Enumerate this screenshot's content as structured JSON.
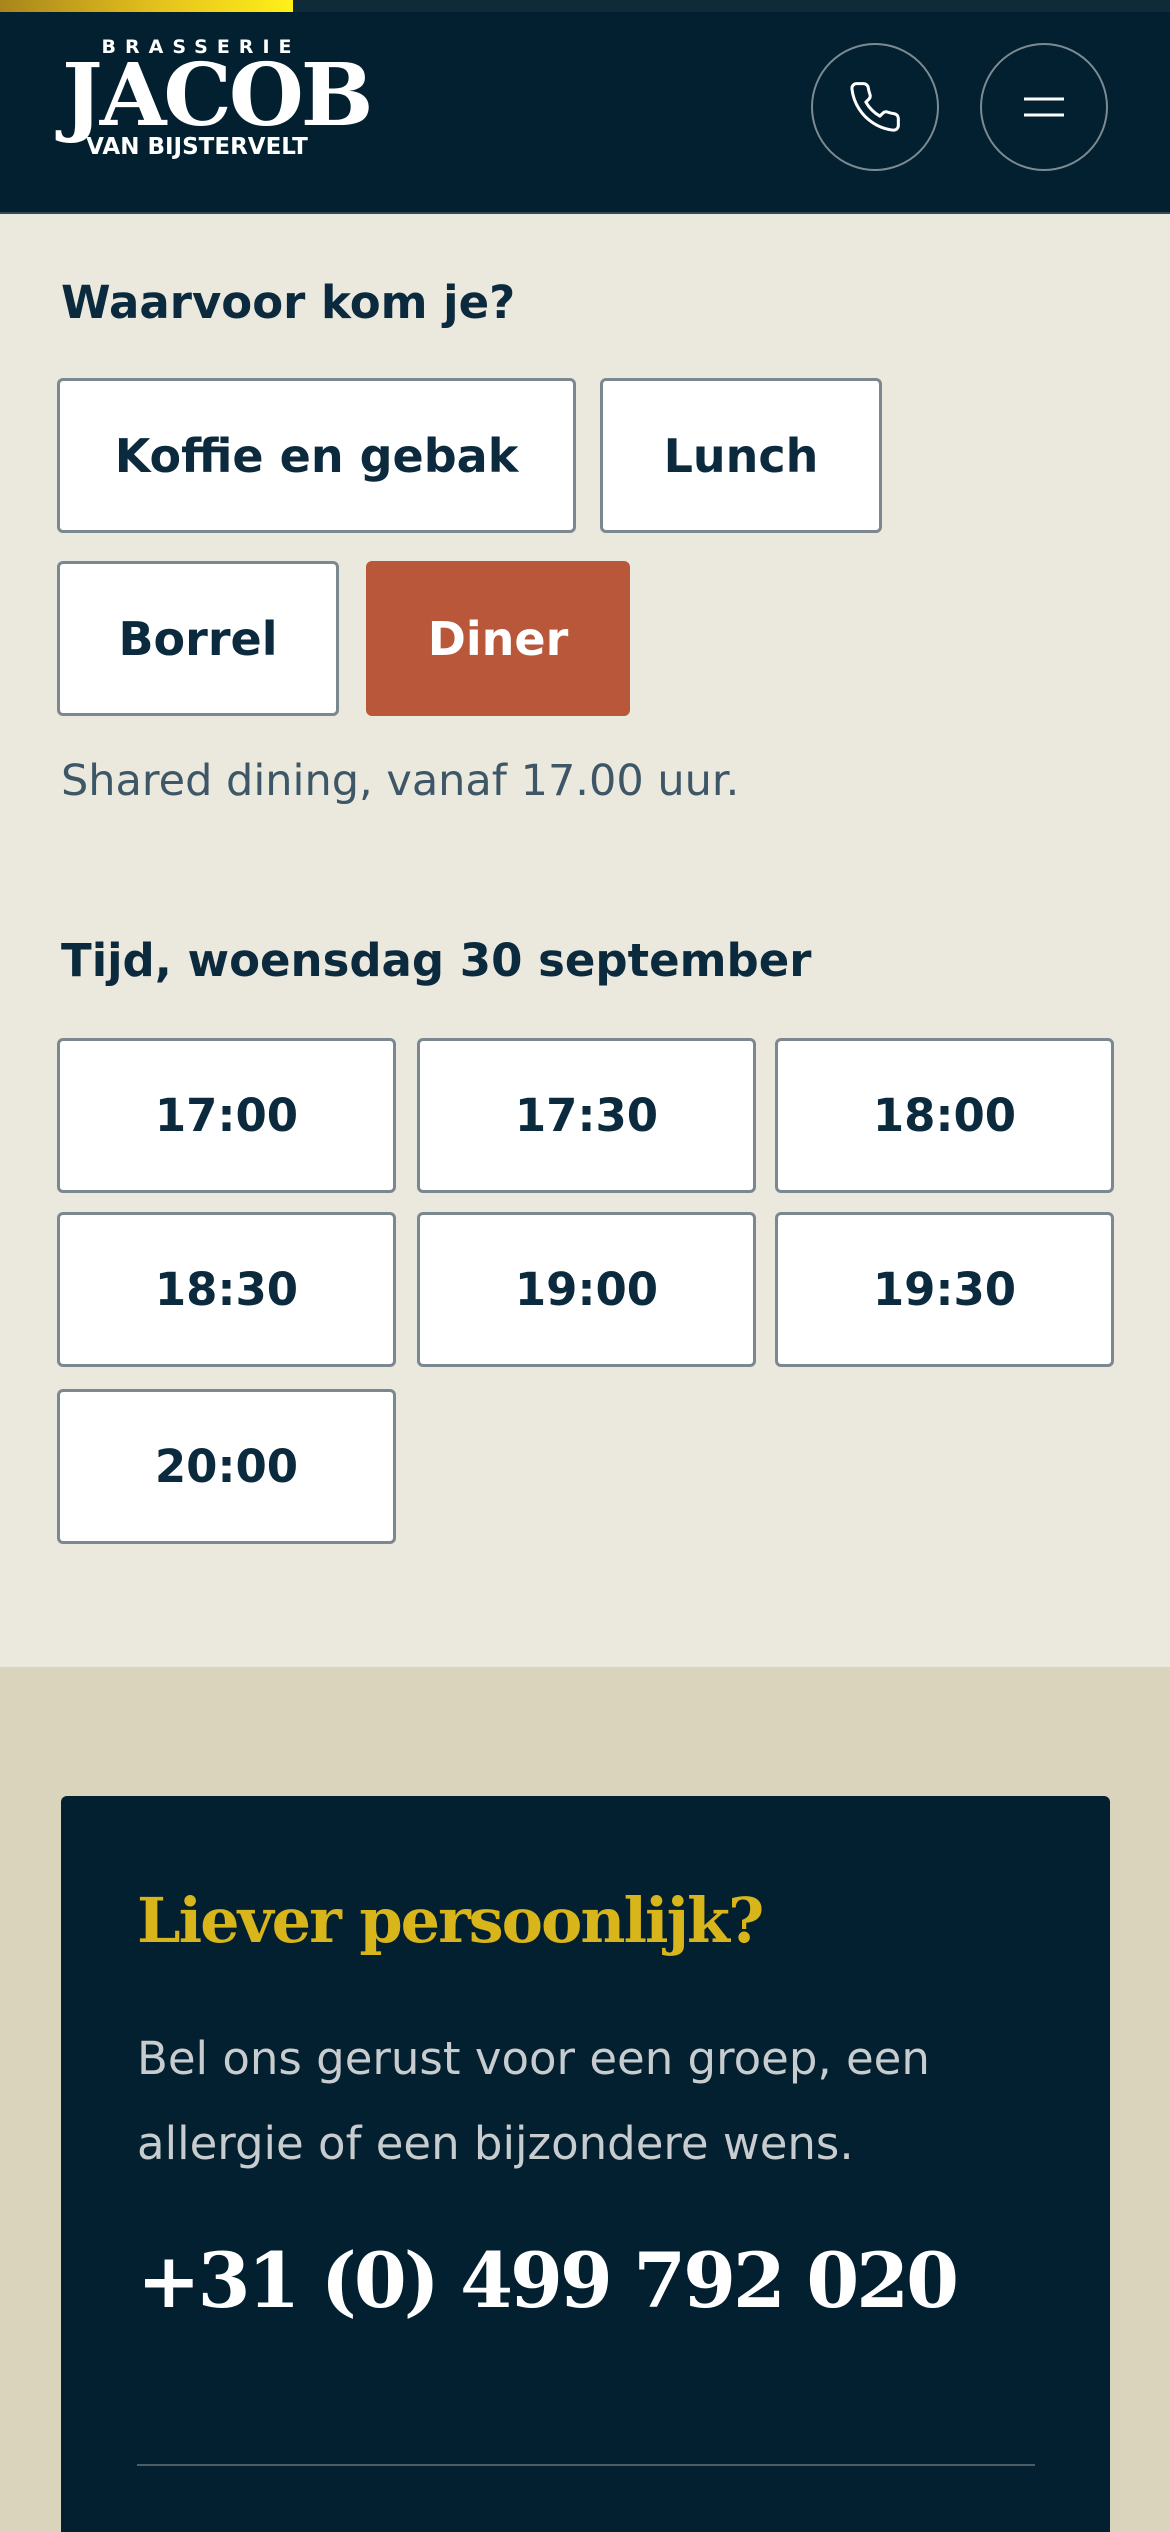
{
  "header": {
    "progress_fraction": 0.25,
    "logo": {
      "top": "BRASSERIE",
      "main": "JACOB",
      "bottom": "VAN BIJSTERVELT"
    },
    "phone_icon": "phone-icon",
    "menu_icon": "hamburger-menu-icon"
  },
  "purpose": {
    "label": "Waarvoor kom je?",
    "options": [
      "Koffie en gebak",
      "Lunch",
      "Borrel",
      "Diner"
    ],
    "selected": "Diner",
    "hint": "Shared dining, vanaf 17.00 uur."
  },
  "time": {
    "label": "Tijd, woensdag 30 september",
    "slots": [
      "17:00",
      "17:30",
      "18:00",
      "18:30",
      "19:00",
      "19:30",
      "20:00"
    ]
  },
  "contact": {
    "title": "Liever persoonlijk?",
    "text": "Bel ons gerust voor een groep, een allergie of een bijzondere wens.",
    "phone": "+31 (0) 499 792 020"
  },
  "colors": {
    "navy": "#02202f",
    "accent_selected": "#b9573b",
    "gold": "#d9b51c",
    "page_bg": "#ebe8de",
    "footer_bg": "#d9d4bb"
  }
}
